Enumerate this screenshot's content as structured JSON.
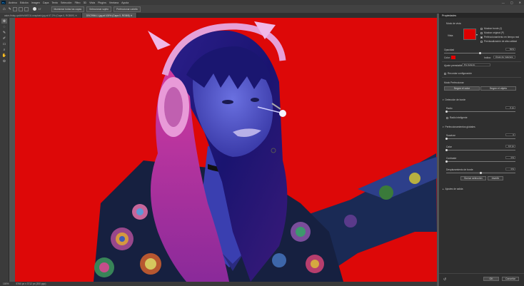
{
  "menu": [
    "Archivo",
    "Edición",
    "Imagen",
    "Capa",
    "Texto",
    "Selección",
    "Filtro",
    "3D",
    "Vista",
    "Plugins",
    "Ventana",
    "Ayuda"
  ],
  "app_icon": "Ps",
  "window_controls": {
    "minimize": "—",
    "maximize": "▢",
    "close": "✕"
  },
  "options_bar": {
    "size_value": "17",
    "buttons": [
      "Muestrear todas las capas",
      "Seleccionar sujeto",
      "Perfeccionar cabello"
    ]
  },
  "tabs": [
    {
      "label": "asier-finlay-qxdkHoW0GU-unsplash.jpg al 67,2% (Capa 0, RGB/8*) ✕",
      "active": false
    },
    {
      "label": "DSC9944-1.jpg al 100% (Capa 0, RGB/8) ✕",
      "active": true
    }
  ],
  "status": {
    "zoom": "100%",
    "doc": "5760 px x 3712 px (300 ppp)"
  },
  "toolbar_icons": [
    "move-icon",
    "lasso-icon",
    "quick-select-icon",
    "brush-icon",
    "eraser-icon",
    "zoom-icon",
    "hand-icon",
    "zoom-out-icon"
  ],
  "panel": {
    "title": "Propiedades",
    "view_mode_label": "Modo de vista",
    "view_label": "Vista:",
    "show_edge": "Mostrar borde (J)",
    "show_original": "Mostrar original (P)",
    "realtime_refine": "Perfeccionamiento en tiempo real",
    "hq_preview": "Previsualización de alta calidad",
    "opacity_label": "Opacidad",
    "opacity_value": "50%",
    "color_label": "Color:",
    "color_value": "#e60000",
    "indicates_label": "Indica:",
    "indicates_value": "Áreas de máscara",
    "preset_label": "Ajuste preestablecido:",
    "preset_value": "Por defecto",
    "remember_settings": "Recordar configuración",
    "refine_mode": "Modo Perfeccionar",
    "mode_color": "Según el color",
    "mode_object": "Según el objeto",
    "edge_detection": "Detección de borde",
    "radius_label": "Radio",
    "radius_value": "0 px",
    "smart_radius": "Radio inteligente",
    "global_refinements": "Perfeccionamientos globales",
    "smooth_label": "Suavizar",
    "smooth_value": "0",
    "feather_label": "Calar",
    "feather_value": "0,0 px",
    "contrast_label": "Contraste",
    "contrast_value": "0%",
    "shift_edge_label": "Desplazamiento de borde",
    "shift_edge_value": "0%",
    "clear_selection": "Borrar selección",
    "invert": "Invertir",
    "output_settings": "Ajustes de salida",
    "ok": "OK",
    "cancel": "Cancelar"
  },
  "colors": {
    "canvas_red": "#dd0808",
    "accent_blue": "#2b4cff",
    "pink": "#e040a0"
  }
}
